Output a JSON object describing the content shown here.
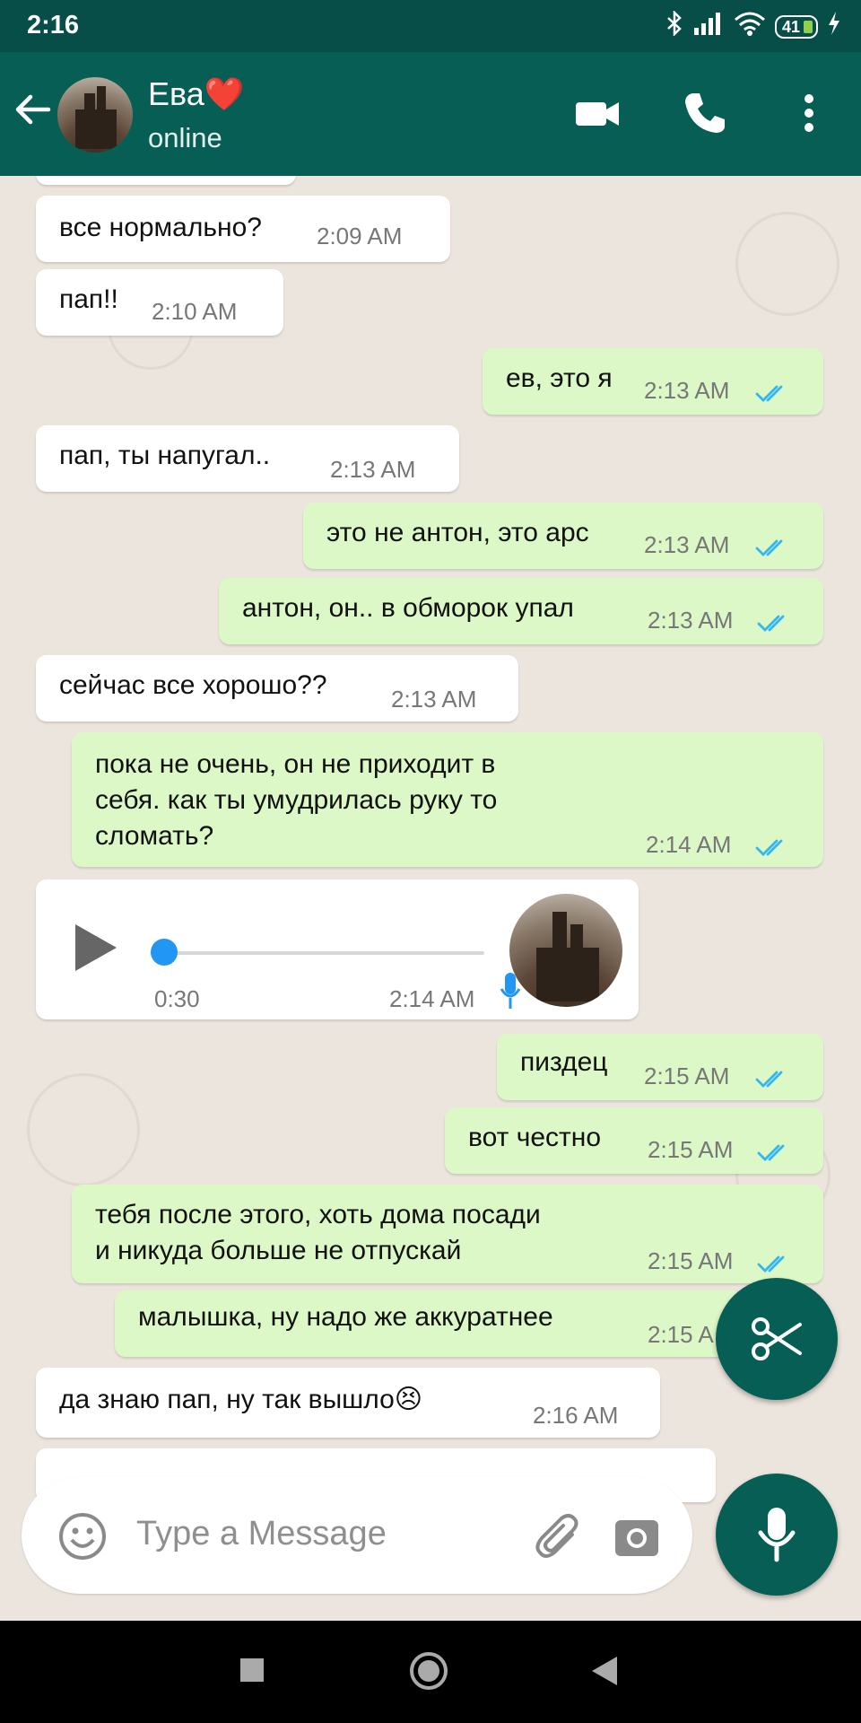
{
  "statusbar": {
    "time": "2:16",
    "battery": "41"
  },
  "header": {
    "contact_name": "Ева❤️",
    "contact_status": "online"
  },
  "messages": [
    {
      "dir": "in",
      "text": "все нормально?",
      "time": "2:09 AM"
    },
    {
      "dir": "in",
      "text": "пап!!",
      "time": "2:10 AM"
    },
    {
      "dir": "out",
      "text": "ев, это я",
      "time": "2:13 AM"
    },
    {
      "dir": "in",
      "text": "пап, ты напугал..",
      "time": "2:13 AM"
    },
    {
      "dir": "out",
      "text": "это не антон, это арс",
      "time": "2:13 AM"
    },
    {
      "dir": "out",
      "text": "антон, он.. в обморок упал",
      "time": "2:13 AM"
    },
    {
      "dir": "in",
      "text": "сейчас все хорошо??",
      "time": "2:13 AM"
    },
    {
      "dir": "out",
      "text": "пока не очень, он не приходит в\nсебя. как ты умудрилась руку то\nсломать?",
      "time": "2:14 AM"
    },
    {
      "dir": "in",
      "type": "voice",
      "duration": "0:30",
      "time": "2:14 AM",
      "progress": 0
    },
    {
      "dir": "out",
      "text": "пиздец",
      "time": "2:15 AM"
    },
    {
      "dir": "out",
      "text": "вот честно",
      "time": "2:15 AM"
    },
    {
      "dir": "out",
      "text": "тебя после этого, хоть дома посади\nи никуда больше не отпускай",
      "time": "2:15 AM"
    },
    {
      "dir": "out",
      "text": "малышка, ну надо же аккуратнее",
      "time": "2:15 A"
    },
    {
      "dir": "in",
      "text": "да знаю пап, ну так вышло😣",
      "time": "2:16 AM"
    }
  ],
  "composer": {
    "placeholder": "Type a Message"
  },
  "colors": {
    "header": "#075e54",
    "outgoing_bubble": "#dcf8c6",
    "incoming_bubble": "#ffffff",
    "read_ticks": "#34b7f1",
    "fab": "#075e54"
  }
}
